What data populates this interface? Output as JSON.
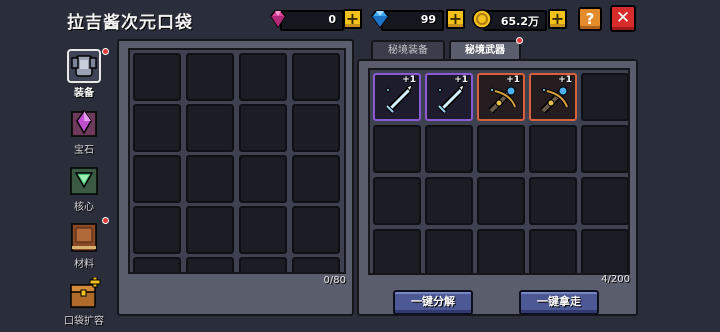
{
  "header": {
    "title": "拉吉酱次元口袋"
  },
  "currencies": {
    "pink_gem": {
      "value": "0",
      "icon": "pink-gem-icon"
    },
    "blue_gem": {
      "value": "99",
      "icon": "blue-gem-icon"
    },
    "coin": {
      "value": "65.2万",
      "icon": "gold-coin-icon"
    }
  },
  "buttons": {
    "plus": "+",
    "help": "?",
    "close": "✕",
    "decompose": "一键分解",
    "take_all": "一键拿走"
  },
  "sidebar": {
    "items": [
      {
        "label": "装备",
        "icon": "armor-icon",
        "active": true,
        "badge": true
      },
      {
        "label": "宝石",
        "icon": "gem-icon",
        "active": false,
        "badge": false
      },
      {
        "label": "核心",
        "icon": "core-icon",
        "active": false,
        "badge": false
      },
      {
        "label": "材料",
        "icon": "book-icon",
        "active": false,
        "badge": true
      },
      {
        "label": "口袋扩容",
        "icon": "chest-expand-icon",
        "active": false,
        "badge": false
      }
    ]
  },
  "left_panel": {
    "count": "0/80"
  },
  "tabs": [
    {
      "label": "秘境装备",
      "active": false
    },
    {
      "label": "秘境武器",
      "active": true
    }
  ],
  "right_panel": {
    "count": "4/200",
    "items": [
      {
        "name": "ice-sword",
        "level": "+1",
        "rarity": "purple"
      },
      {
        "name": "ice-sword",
        "level": "+1",
        "rarity": "purple"
      },
      {
        "name": "crossbow",
        "level": "+1",
        "rarity": "orange"
      },
      {
        "name": "crossbow",
        "level": "+1",
        "rarity": "orange"
      }
    ]
  },
  "colors": {
    "bg": "#2a2e3a",
    "panel": "#5a5e6c",
    "slot": "#1b1d25",
    "purple_rarity": "#8a5ad6",
    "orange_rarity": "#d8603a",
    "action_button": "#4d5994"
  }
}
